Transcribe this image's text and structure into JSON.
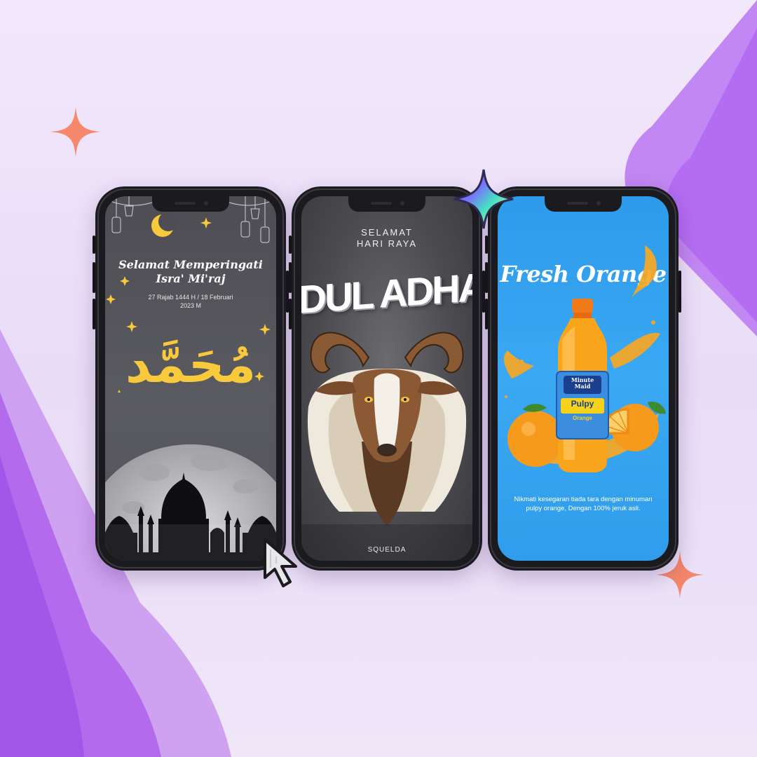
{
  "colors": {
    "accent_purple": "#b46df2",
    "gold": "#f7c93b",
    "sky": "#35a3f0",
    "orange": "#f59a1a"
  },
  "phone1": {
    "title_line1": "Selamat Memperingati",
    "title_line2": "Isra' Mi'raj",
    "date_line1": "27 Rajab 1444 H / 18 Februari",
    "date_line2": "2023 M",
    "calligraphy": "مُحَمَّد"
  },
  "phone2": {
    "subtitle_line1": "SELAMAT",
    "subtitle_line2": "HARI RAYA",
    "headline": "IDUL ADHA",
    "brand": "SQUELDA"
  },
  "phone3": {
    "headline": "Fresh Orange",
    "bottle_brand_line1": "Minute",
    "bottle_brand_line2": "Maid",
    "bottle_product": "Pulpy",
    "bottle_flavor": "Orange",
    "body": "Nikmati kesegaran tiada tara dengan minuman pulpy orange, Dengan 100% jeruk asli."
  },
  "icons": [
    "sparkle-icon",
    "star-icon",
    "cursor-icon"
  ]
}
